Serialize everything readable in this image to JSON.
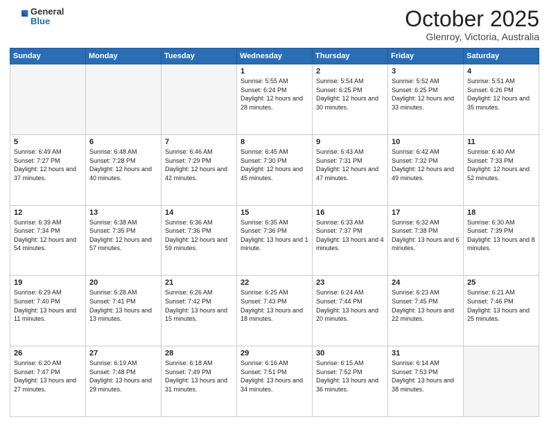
{
  "header": {
    "logo": {
      "general": "General",
      "blue": "Blue"
    },
    "title": "October 2025",
    "subtitle": "Glenroy, Victoria, Australia"
  },
  "weekdays": [
    "Sunday",
    "Monday",
    "Tuesday",
    "Wednesday",
    "Thursday",
    "Friday",
    "Saturday"
  ],
  "weeks": [
    [
      {
        "day": null
      },
      {
        "day": null
      },
      {
        "day": null
      },
      {
        "day": 1,
        "sunrise": "5:55 AM",
        "sunset": "6:24 PM",
        "daylight": "12 hours and 28 minutes."
      },
      {
        "day": 2,
        "sunrise": "5:54 AM",
        "sunset": "6:25 PM",
        "daylight": "12 hours and 30 minutes."
      },
      {
        "day": 3,
        "sunrise": "5:52 AM",
        "sunset": "6:25 PM",
        "daylight": "12 hours and 33 minutes."
      },
      {
        "day": 4,
        "sunrise": "5:51 AM",
        "sunset": "6:26 PM",
        "daylight": "12 hours and 35 minutes."
      }
    ],
    [
      {
        "day": 5,
        "sunrise": "6:49 AM",
        "sunset": "7:27 PM",
        "daylight": "12 hours and 37 minutes."
      },
      {
        "day": 6,
        "sunrise": "6:48 AM",
        "sunset": "7:28 PM",
        "daylight": "12 hours and 40 minutes."
      },
      {
        "day": 7,
        "sunrise": "6:46 AM",
        "sunset": "7:29 PM",
        "daylight": "12 hours and 42 minutes."
      },
      {
        "day": 8,
        "sunrise": "6:45 AM",
        "sunset": "7:30 PM",
        "daylight": "12 hours and 45 minutes."
      },
      {
        "day": 9,
        "sunrise": "6:43 AM",
        "sunset": "7:31 PM",
        "daylight": "12 hours and 47 minutes."
      },
      {
        "day": 10,
        "sunrise": "6:42 AM",
        "sunset": "7:32 PM",
        "daylight": "12 hours and 49 minutes."
      },
      {
        "day": 11,
        "sunrise": "6:40 AM",
        "sunset": "7:33 PM",
        "daylight": "12 hours and 52 minutes."
      }
    ],
    [
      {
        "day": 12,
        "sunrise": "6:39 AM",
        "sunset": "7:34 PM",
        "daylight": "12 hours and 54 minutes."
      },
      {
        "day": 13,
        "sunrise": "6:38 AM",
        "sunset": "7:35 PM",
        "daylight": "12 hours and 57 minutes."
      },
      {
        "day": 14,
        "sunrise": "6:36 AM",
        "sunset": "7:36 PM",
        "daylight": "12 hours and 59 minutes."
      },
      {
        "day": 15,
        "sunrise": "6:35 AM",
        "sunset": "7:36 PM",
        "daylight": "13 hours and 1 minute."
      },
      {
        "day": 16,
        "sunrise": "6:33 AM",
        "sunset": "7:37 PM",
        "daylight": "13 hours and 4 minutes."
      },
      {
        "day": 17,
        "sunrise": "6:32 AM",
        "sunset": "7:38 PM",
        "daylight": "13 hours and 6 minutes."
      },
      {
        "day": 18,
        "sunrise": "6:30 AM",
        "sunset": "7:39 PM",
        "daylight": "13 hours and 8 minutes."
      }
    ],
    [
      {
        "day": 19,
        "sunrise": "6:29 AM",
        "sunset": "7:40 PM",
        "daylight": "13 hours and 11 minutes."
      },
      {
        "day": 20,
        "sunrise": "6:28 AM",
        "sunset": "7:41 PM",
        "daylight": "13 hours and 13 minutes."
      },
      {
        "day": 21,
        "sunrise": "6:26 AM",
        "sunset": "7:42 PM",
        "daylight": "13 hours and 15 minutes."
      },
      {
        "day": 22,
        "sunrise": "6:25 AM",
        "sunset": "7:43 PM",
        "daylight": "13 hours and 18 minutes."
      },
      {
        "day": 23,
        "sunrise": "6:24 AM",
        "sunset": "7:44 PM",
        "daylight": "13 hours and 20 minutes."
      },
      {
        "day": 24,
        "sunrise": "6:23 AM",
        "sunset": "7:45 PM",
        "daylight": "13 hours and 22 minutes."
      },
      {
        "day": 25,
        "sunrise": "6:21 AM",
        "sunset": "7:46 PM",
        "daylight": "13 hours and 25 minutes."
      }
    ],
    [
      {
        "day": 26,
        "sunrise": "6:20 AM",
        "sunset": "7:47 PM",
        "daylight": "13 hours and 27 minutes."
      },
      {
        "day": 27,
        "sunrise": "6:19 AM",
        "sunset": "7:48 PM",
        "daylight": "13 hours and 29 minutes."
      },
      {
        "day": 28,
        "sunrise": "6:18 AM",
        "sunset": "7:49 PM",
        "daylight": "13 hours and 31 minutes."
      },
      {
        "day": 29,
        "sunrise": "6:16 AM",
        "sunset": "7:51 PM",
        "daylight": "13 hours and 34 minutes."
      },
      {
        "day": 30,
        "sunrise": "6:15 AM",
        "sunset": "7:52 PM",
        "daylight": "13 hours and 36 minutes."
      },
      {
        "day": 31,
        "sunrise": "6:14 AM",
        "sunset": "7:53 PM",
        "daylight": "13 hours and 38 minutes."
      },
      {
        "day": null
      }
    ]
  ]
}
